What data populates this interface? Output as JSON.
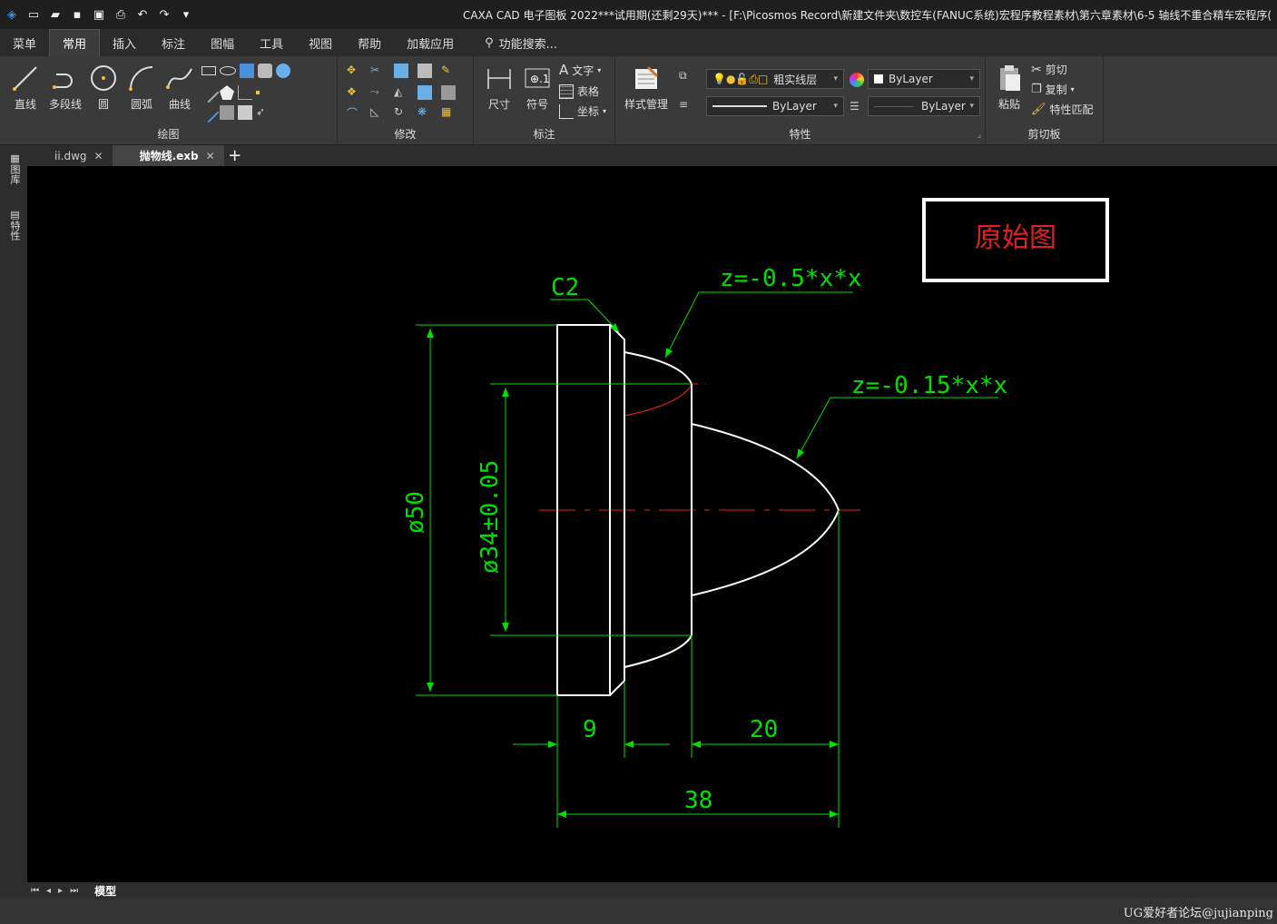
{
  "titlebar": {
    "title": "CAXA CAD 电子图板 2022***试用期(还剩29天)*** - [F:\\Picosmos Record\\新建文件夹\\数控车(FANUC系统)宏程序教程素材\\第六章素材\\6-5 轴线不重合精车宏程序("
  },
  "menu": {
    "tabs": [
      "菜单",
      "常用",
      "插入",
      "标注",
      "图幅",
      "工具",
      "视图",
      "帮助",
      "加载应用"
    ],
    "search_label": "功能搜索..."
  },
  "ribbon": {
    "draw": {
      "label": "绘图",
      "line": "直线",
      "polyline": "多段线",
      "circle": "圆",
      "arc": "圆弧",
      "curve": "曲线"
    },
    "modify": {
      "label": "修改"
    },
    "annot": {
      "label": "标注",
      "dimension": "尺寸",
      "symbol": "符号",
      "text": "文字",
      "table": "表格",
      "coord": "坐标"
    },
    "props": {
      "label": "特性",
      "style_manager": "样式管理",
      "layer": "粗实线层",
      "color": "ByLayer",
      "linetype": "ByLayer",
      "lineweight": "ByLayer"
    },
    "clipboard": {
      "label": "剪切板",
      "paste": "粘贴",
      "cut": "剪切",
      "copy": "复制",
      "match": "特性匹配"
    }
  },
  "doctabs": [
    {
      "name": "ii.dwg",
      "active": false
    },
    {
      "name": "抛物线.exb",
      "active": true
    }
  ],
  "leftpanel": {
    "lib": "图库",
    "props": "特性"
  },
  "drawing": {
    "label_box": "原始图",
    "chamfer": "C2",
    "eq1": "z=-0.5*x*x",
    "eq2": "z=-0.15*x*x",
    "dia_outer": "ø50",
    "dia_inner": "ø34±0.05",
    "dim_9": "9",
    "dim_20": "20",
    "dim_38": "38",
    "colors": {
      "dim": "#00e000",
      "geo": "#ffffff",
      "center": "#e02020",
      "label": "#e02020"
    }
  },
  "layoutbar": {
    "model_tab": "模型"
  },
  "watermark": "UG爱好者论坛@jujianping"
}
